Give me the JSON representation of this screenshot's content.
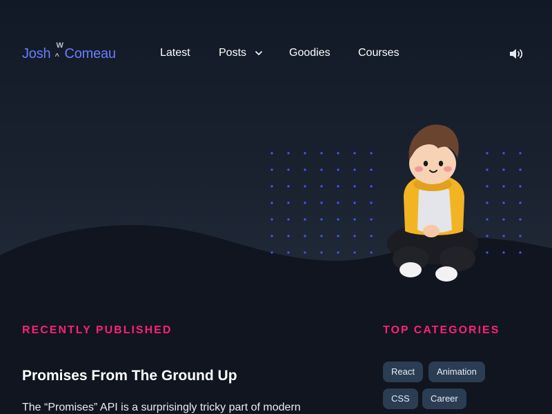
{
  "logo": {
    "first": "Josh",
    "last": "Comeau",
    "mark_top": "W",
    "mark_bottom": "^"
  },
  "nav": {
    "items": [
      {
        "label": "Latest"
      },
      {
        "label": "Posts",
        "has_dropdown": true
      },
      {
        "label": "Goodies"
      },
      {
        "label": "Courses"
      }
    ]
  },
  "controls": {
    "theme_icon": "moon-icon",
    "sound_icon": "speaker-icon"
  },
  "colors": {
    "accent_pink": "#ff1f79",
    "logo_blue": "#6b7cff",
    "dot_blue": "#3f5bff",
    "tag_bg": "#2b3d52",
    "background": "#101520"
  },
  "recent": {
    "heading": "RECENTLY PUBLISHED",
    "post_title": "Promises From The Ground Up",
    "post_excerpt": "The “Promises” API is a surprisingly tricky part of modern"
  },
  "categories": {
    "heading": "TOP CATEGORIES",
    "tags": [
      "React",
      "Animation",
      "CSS",
      "Career"
    ]
  }
}
